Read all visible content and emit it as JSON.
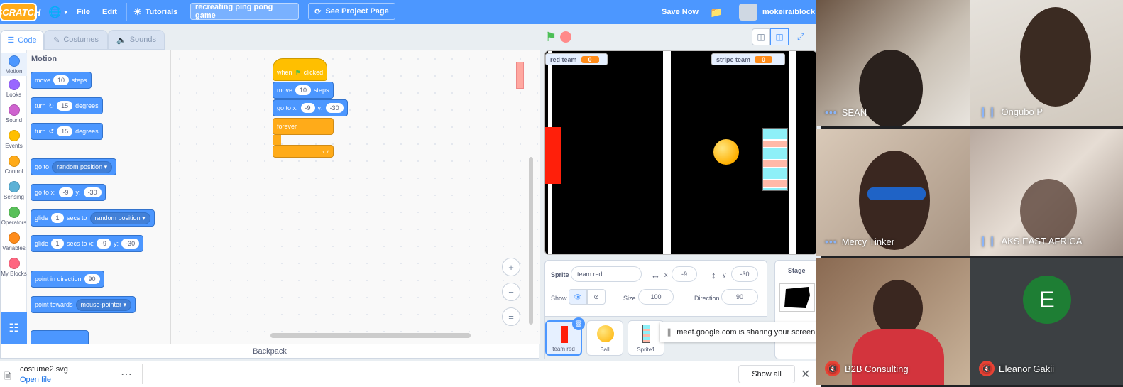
{
  "menubar": {
    "logo": "SCRATCH",
    "file": "File",
    "edit": "Edit",
    "tutorials": "Tutorials",
    "project_title": "recreating ping pong game",
    "see_project_page": "See Project Page",
    "save_now": "Save Now",
    "username": "mokeiraiblock"
  },
  "tabs": {
    "code": "Code",
    "costumes": "Costumes",
    "sounds": "Sounds"
  },
  "categories": [
    {
      "label": "Motion",
      "color": "#4c97ff"
    },
    {
      "label": "Looks",
      "color": "#9966ff"
    },
    {
      "label": "Sound",
      "color": "#cf63cf"
    },
    {
      "label": "Events",
      "color": "#ffbf00"
    },
    {
      "label": "Control",
      "color": "#ffab19"
    },
    {
      "label": "Sensing",
      "color": "#5cb1d6"
    },
    {
      "label": "Operators",
      "color": "#59c059"
    },
    {
      "label": "Variables",
      "color": "#ff8c1a"
    },
    {
      "label": "My Blocks",
      "color": "#ff6680"
    }
  ],
  "palette": {
    "header": "Motion",
    "move": {
      "a": "move",
      "v": "10",
      "b": "steps"
    },
    "turn_cw": {
      "a": "turn",
      "v": "15",
      "b": "degrees"
    },
    "turn_ccw": {
      "a": "turn",
      "v": "15",
      "b": "degrees"
    },
    "go_to": {
      "a": "go to",
      "dd": "random position"
    },
    "go_to_xy": {
      "a": "go to x:",
      "x": "-9",
      "b": "y:",
      "y": "-30"
    },
    "glide_to": {
      "a": "glide",
      "v": "1",
      "b": "secs to",
      "dd": "random position"
    },
    "glide_xy": {
      "a": "glide",
      "v": "1",
      "b": "secs to x:",
      "x": "-9",
      "c": "y:",
      "y": "-30"
    },
    "point_dir": {
      "a": "point in direction",
      "v": "90"
    },
    "point_towards": {
      "a": "point towards",
      "dd": "mouse-pointer"
    }
  },
  "script": {
    "hat": {
      "a": "when",
      "b": "clicked"
    },
    "move": {
      "a": "move",
      "v": "10",
      "b": "steps"
    },
    "goto": {
      "a": "go to x:",
      "x": "-9",
      "b": "y:",
      "y": "-30"
    },
    "forever": "forever"
  },
  "backpack": "Backpack",
  "stage": {
    "red_team": {
      "label": "red team",
      "value": "0"
    },
    "stripe_team": {
      "label": "stripe team",
      "value": "0"
    }
  },
  "sprite_info": {
    "sprite_label": "Sprite",
    "sprite_name": "team red",
    "x_label": "x",
    "x": "-9",
    "y_label": "y",
    "y": "-30",
    "show_label": "Show",
    "size_label": "Size",
    "size": "100",
    "direction_label": "Direction",
    "direction": "90"
  },
  "sprites": [
    {
      "name": "team red"
    },
    {
      "name": "Ball"
    },
    {
      "name": "Sprite1"
    }
  ],
  "stage_panel": {
    "label": "Stage"
  },
  "share_notice": "meet.google.com is sharing your screen.",
  "download": {
    "file": "costume2.svg",
    "open": "Open file",
    "show_all": "Show all"
  },
  "participants": [
    {
      "name": "SEAN"
    },
    {
      "name": "Ongubo P"
    },
    {
      "name": "Mercy Tinker"
    },
    {
      "name": "AKS EAST AFRICA"
    },
    {
      "name": "B2B Consulting"
    },
    {
      "name": "Eleanor Gakii",
      "initial": "E"
    }
  ]
}
